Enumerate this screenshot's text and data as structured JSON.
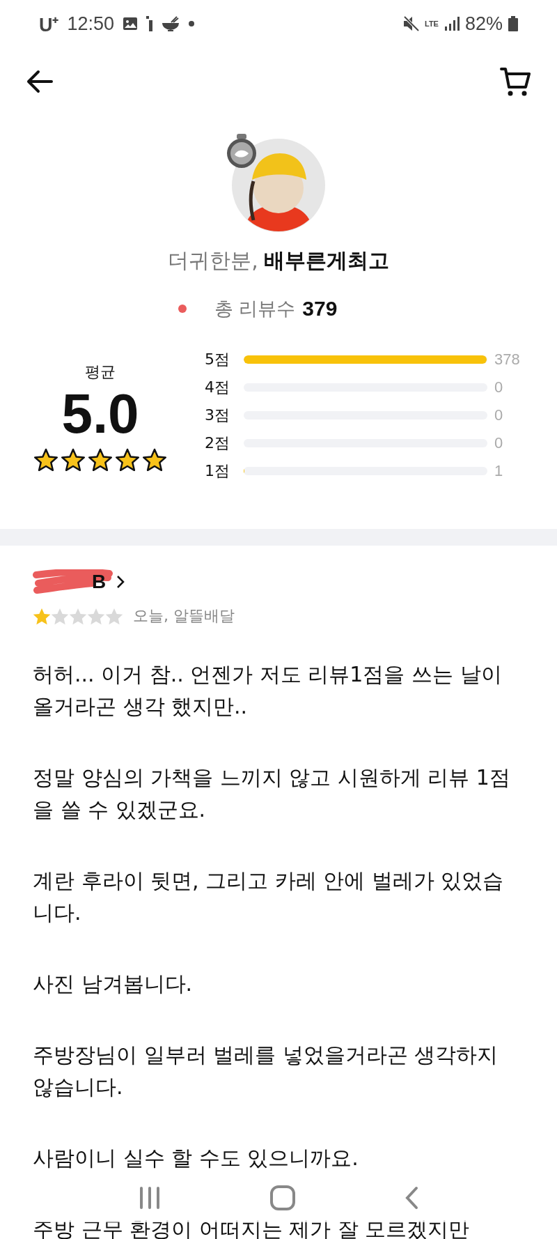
{
  "status_bar": {
    "carrier": "U⁺",
    "time": "12:50",
    "network": "LTE",
    "battery": "82%"
  },
  "profile": {
    "grade": "더귀한분,",
    "nickname": "배부른게최고",
    "review_count_label": "총 리뷰수",
    "review_count": "379"
  },
  "rating_summary": {
    "average_label": "평균",
    "average": "5.0",
    "stars": 5,
    "distribution": [
      {
        "label": "5점",
        "level": 0.997,
        "count": "378"
      },
      {
        "label": "4점",
        "count": "0"
      },
      {
        "label": "3점",
        "count": "0"
      },
      {
        "label": "2점",
        "count": "0"
      },
      {
        "label": "1점",
        "level": 0.003,
        "count": "1"
      }
    ]
  },
  "review": {
    "reviewer": "B",
    "stars": 1,
    "meta": "오늘, 알뜰배달",
    "paragraphs": [
      "허허... 이거 참.. 언젠가 저도 리뷰1점을 쓰는 날이 올거라곤 생각 했지만..",
      "정말 양심의 가책을 느끼지 않고 시원하게 리뷰 1점을 쓸 수 있겠군요.",
      "계란 후라이 뒷면, 그리고 카레 안에 벌레가 있었습니다.",
      "사진 남겨봅니다.",
      "주방장님이 일부러 벌레를 넣었을거라곤 생각하지 않습니다.",
      "사람이니 실수 할 수도 있으니까요.",
      "주방 근무 환경이 어떠지는 제가 잘 모르겠지만"
    ]
  }
}
